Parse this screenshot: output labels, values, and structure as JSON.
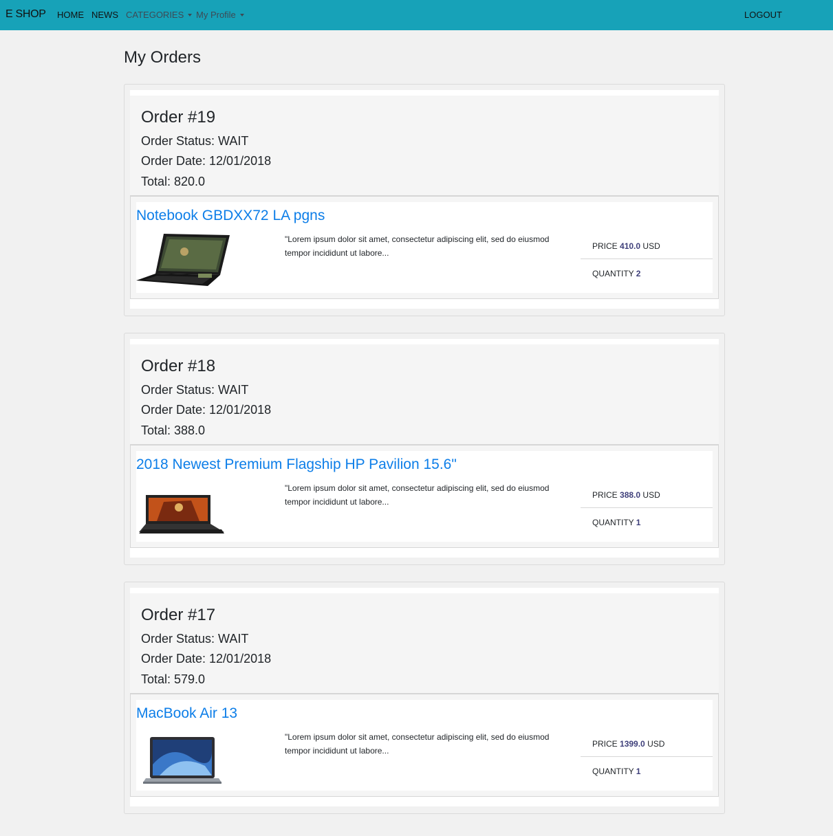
{
  "nav": {
    "brand": "E SHOP",
    "home": "HOME",
    "news": "NEWS",
    "categories": "CATEGORIES",
    "profile": "My Profile",
    "logout": "LOGOUT"
  },
  "page": {
    "title": "My Orders"
  },
  "labels": {
    "price": "PRICE",
    "currency": "USD",
    "quantity": "QUANTITY"
  },
  "orders": [
    {
      "title": "Order #19",
      "status": "Order Status: WAIT",
      "date": "Order Date: 12/01/2018",
      "total": "Total: 820.0",
      "item": {
        "name": "Notebook GBDXX72 LA pgns",
        "image": "black-gaming-laptop",
        "desc": "\"Lorem ipsum dolor sit amet, consectetur adipiscing elit, sed do eiusmod tempor incididunt ut labore...",
        "price": "410.0",
        "quantity": "2"
      }
    },
    {
      "title": "Order #18",
      "status": "Order Status: WAIT",
      "date": "Order Date: 12/01/2018",
      "total": "Total: 388.0",
      "item": {
        "name": "2018 Newest Premium Flagship HP Pavilion 15.6\"",
        "image": "hp-pavilion-laptop",
        "desc": "\"Lorem ipsum dolor sit amet, consectetur adipiscing elit, sed do eiusmod tempor incididunt ut labore...",
        "price": "388.0",
        "quantity": "1"
      }
    },
    {
      "title": "Order #17",
      "status": "Order Status: WAIT",
      "date": "Order Date: 12/01/2018",
      "total": "Total: 579.0",
      "item": {
        "name": "MacBook Air 13",
        "image": "macbook-air-laptop",
        "desc": "\"Lorem ipsum dolor sit amet, consectetur adipiscing elit, sed do eiusmod tempor incididunt ut labore...",
        "price": "1399.0",
        "quantity": "1"
      }
    }
  ],
  "colors": {
    "navbar": "#17a2b8",
    "link": "#0d7ee8",
    "accentValue": "#3e3f7a"
  }
}
